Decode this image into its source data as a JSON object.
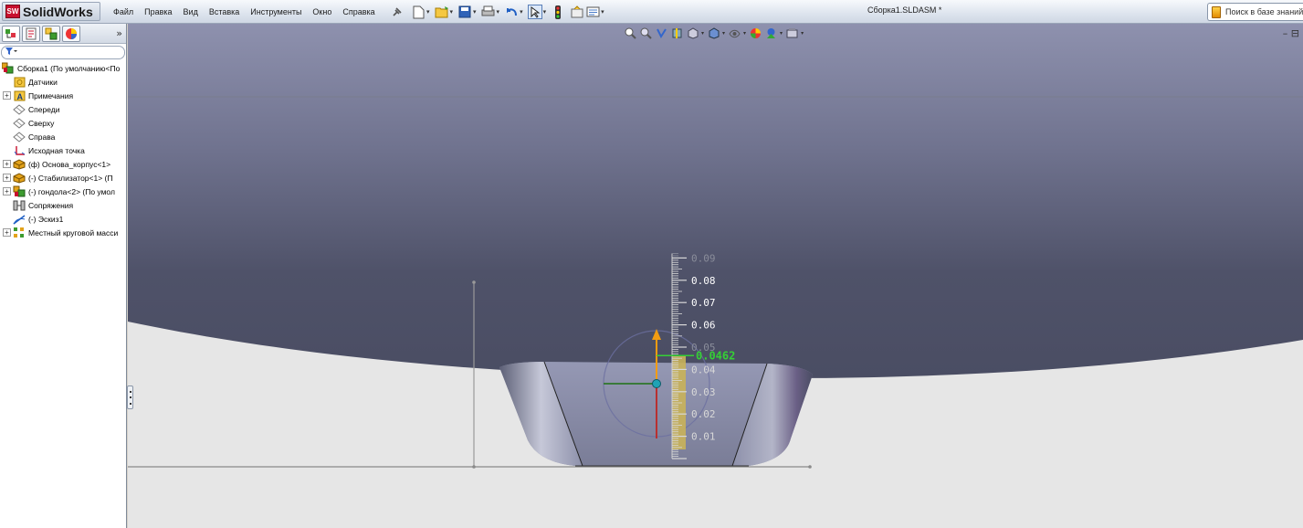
{
  "app": {
    "logo_text": "SolidWorks",
    "logo_mark": "SW",
    "document_title": "Сборка1.SLDASM *"
  },
  "menu": [
    "Файл",
    "Правка",
    "Вид",
    "Вставка",
    "Инструменты",
    "Окно",
    "Справка"
  ],
  "toolbar_icons": [
    "pin-icon",
    "new-document-icon",
    "open-folder-icon",
    "save-icon",
    "print-icon",
    "undo-icon",
    "select-arrow-icon",
    "traffic-light-icon",
    "options-icon",
    "properties-icon"
  ],
  "search": {
    "placeholder": "Поиск в базе знаний"
  },
  "feature_tree": {
    "tabs": [
      "feature-manager-icon",
      "property-manager-icon",
      "configuration-manager-icon",
      "display-manager-icon"
    ],
    "collapse_glyph": "»",
    "items": [
      {
        "label": "Сборка1  (По умолчанию<По",
        "icon": "assembly-icon",
        "expandable": false,
        "indent": 0
      },
      {
        "label": "Датчики",
        "icon": "sensors-folder-icon",
        "expandable": false,
        "indent": 1
      },
      {
        "label": "Примечания",
        "icon": "annotations-icon",
        "expandable": true,
        "indent": 1
      },
      {
        "label": "Спереди",
        "icon": "plane-icon",
        "expandable": false,
        "indent": 1
      },
      {
        "label": "Сверху",
        "icon": "plane-icon",
        "expandable": false,
        "indent": 1
      },
      {
        "label": "Справа",
        "icon": "plane-icon",
        "expandable": false,
        "indent": 1
      },
      {
        "label": "Исходная точка",
        "icon": "origin-icon",
        "expandable": false,
        "indent": 1
      },
      {
        "label": "(ф) Основа_корпус<1>",
        "icon": "part-icon",
        "expandable": true,
        "indent": 1
      },
      {
        "label": "(-) Стабилизатор<1> (П",
        "icon": "part-icon",
        "expandable": true,
        "indent": 1
      },
      {
        "label": "(-) гондола<2> (По умол",
        "icon": "subassembly-icon",
        "expandable": true,
        "indent": 1
      },
      {
        "label": "Сопряжения",
        "icon": "mates-icon",
        "expandable": false,
        "indent": 1
      },
      {
        "label": "(-) Эскиз1",
        "icon": "sketch-icon",
        "expandable": false,
        "indent": 1
      },
      {
        "label": "Местный круговой масси",
        "icon": "circular-pattern-icon",
        "expandable": true,
        "indent": 1
      }
    ]
  },
  "view_toolbar_icons": [
    "zoom-to-fit-icon",
    "zoom-area-icon",
    "previous-view-icon",
    "section-view-icon",
    "view-orientation-icon",
    "display-style-icon",
    "hide-show-icon",
    "appearance-icon",
    "scene-icon",
    "view-settings-icon"
  ],
  "ruler": {
    "ticks": [
      "0.09",
      "0.08",
      "0.07",
      "0.06",
      "0.05",
      "0.04",
      "0.03",
      "0.02",
      "0.01"
    ],
    "current_value": "0.0462"
  },
  "colors": {
    "blimp_top": "#8c8fae",
    "blimp_bottom": "#4a4d63",
    "gondola": "#8c8fa8",
    "ruler_fill": "#c9b35a",
    "readout": "#35d035",
    "background": "#e6e6e6"
  }
}
